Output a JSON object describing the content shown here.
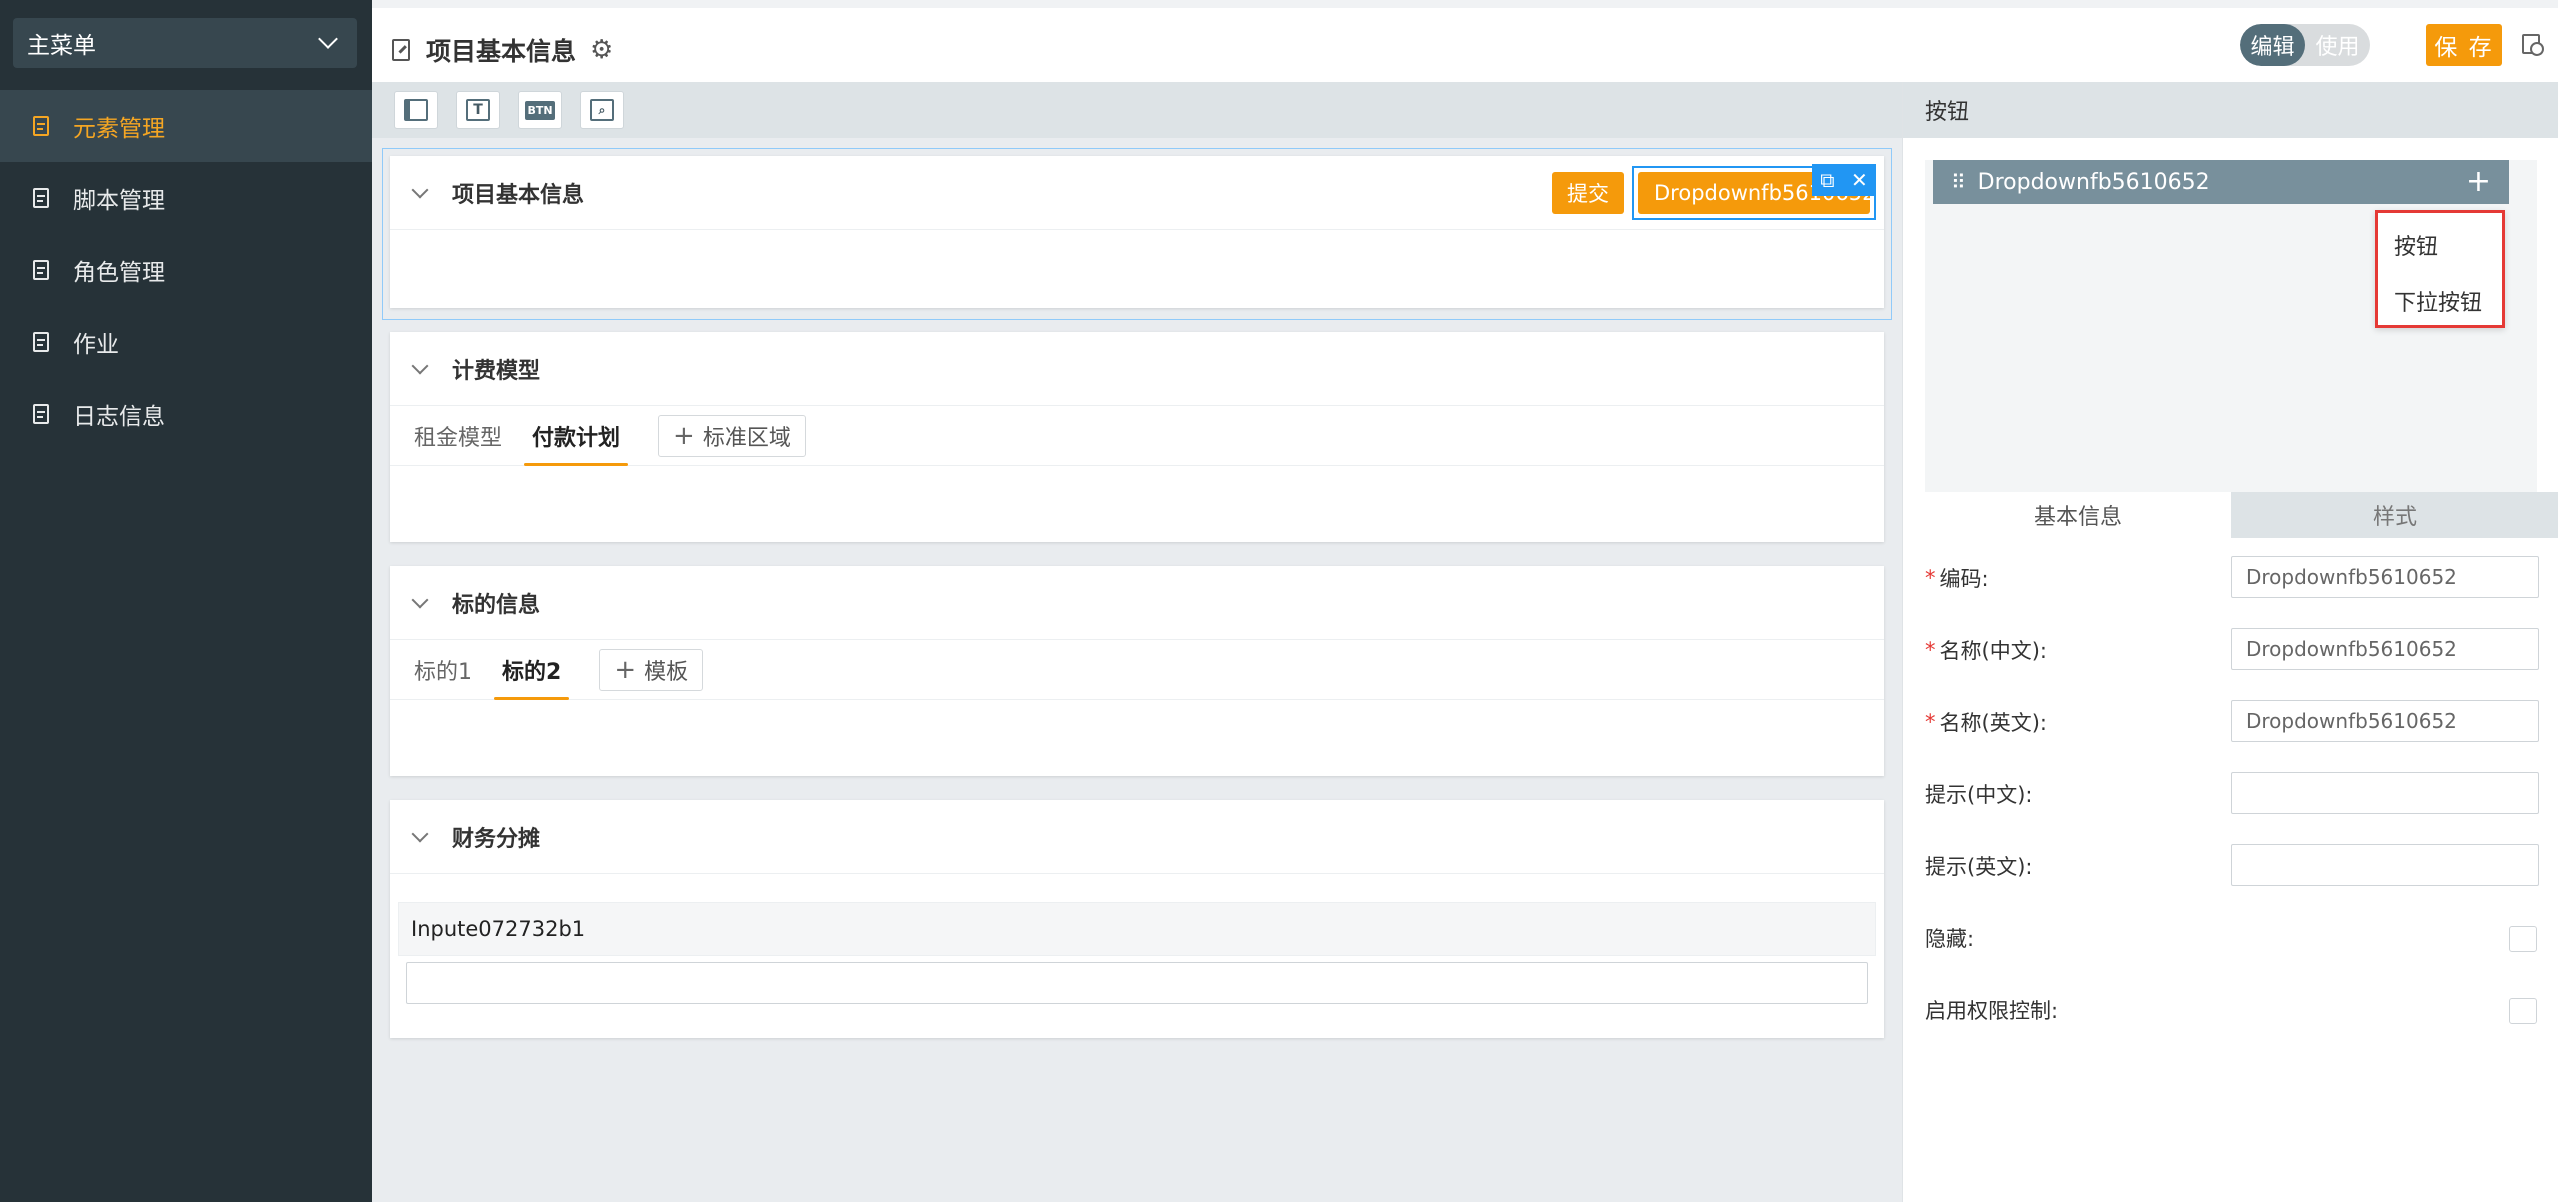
{
  "sidebar": {
    "menu_title": "主菜单",
    "items": [
      {
        "label": "元素管理"
      },
      {
        "label": "脚本管理"
      },
      {
        "label": "角色管理"
      },
      {
        "label": "作业"
      },
      {
        "label": "日志信息"
      }
    ]
  },
  "header": {
    "title": "项目基本信息",
    "mode_edit": "编辑",
    "mode_use": "使用",
    "save_label": "保 存"
  },
  "toolbar": {
    "t_icon_text": "T",
    "btn_icon_text": "BTN"
  },
  "canvas": {
    "panels": [
      {
        "title": "项目基本信息",
        "submit_label": "提交",
        "dropdown_label": "Dropdownfb5610652"
      },
      {
        "title": "计费模型",
        "tabs": [
          "租金模型",
          "付款计划"
        ],
        "add_label": "标准区域"
      },
      {
        "title": "标的信息",
        "tabs": [
          "标的1",
          "标的2"
        ],
        "add_label": "模板"
      },
      {
        "title": "财务分摊",
        "field_label": "Inpute072732b1"
      }
    ]
  },
  "right_panel": {
    "title": "按钮",
    "item_label": "Dropdownfb5610652",
    "dropdown_options": [
      "按钮",
      "下拉按钮"
    ],
    "tabs": [
      "基本信息",
      "样式"
    ],
    "form": [
      {
        "label": "编码:",
        "required": "*",
        "value": "Dropdownfb5610652"
      },
      {
        "label": "名称(中文):",
        "required": "*",
        "value": "Dropdownfb5610652"
      },
      {
        "label": "名称(英文):",
        "required": "*",
        "value": "Dropdownfb5610652"
      },
      {
        "label": "提示(中文):",
        "value": ""
      },
      {
        "label": "提示(英文):",
        "value": ""
      },
      {
        "label": "隐藏:"
      },
      {
        "label": "启用权限控制:"
      }
    ]
  },
  "colors": {
    "accent": "#f59a0b",
    "sidebar_bg": "#263238",
    "selection": "#2196f3",
    "highlight_border": "#e53935"
  }
}
